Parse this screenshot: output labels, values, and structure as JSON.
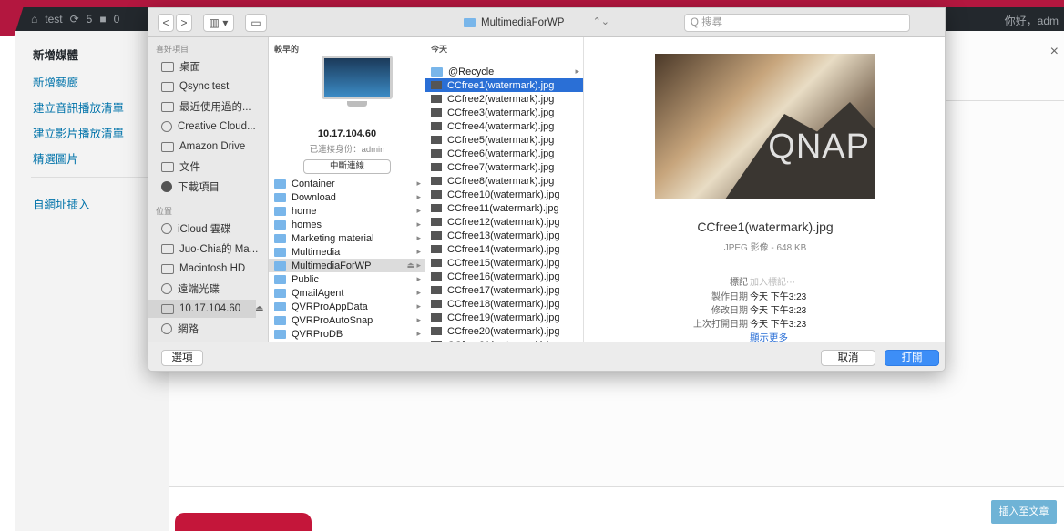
{
  "admin_bar": {
    "site": "test",
    "updates": "5",
    "comments": "0",
    "greeting": "你好，adm"
  },
  "wp": {
    "sidebar": [
      "新增媒體",
      "新增藝廊",
      "建立音訊播放清單",
      "建立影片播放清單",
      "精選圖片",
      "自網址插入"
    ],
    "close": "×",
    "insert_button": "插入至文章"
  },
  "finder": {
    "toolbar": {
      "back": "<",
      "forward": ">",
      "view": "▥ ▾",
      "new_folder": "▭",
      "location": "MultimediaForWP",
      "search_placeholder": "Q 搜尋"
    },
    "sidebar": {
      "favorites_header": "喜好項目",
      "favorites": [
        "桌面",
        "Qsync test",
        "最近使用過的...",
        "Creative Cloud...",
        "Amazon Drive",
        "文件",
        "下載項目"
      ],
      "locations_header": "位置",
      "locations": [
        "iCloud 雲碟",
        "Juo-Chia的 Ma...",
        "Macintosh HD",
        "遠端光碟",
        "10.17.104.60",
        "網路"
      ]
    },
    "col1": {
      "header": "較早的",
      "server_name": "10.17.104.60",
      "server_user": "已連接身份：admin",
      "disconnect": "中斷連線",
      "folders": [
        "Container",
        "Download",
        "home",
        "homes",
        "Marketing material",
        "Multimedia",
        "MultimediaForWP",
        "Public",
        "QmailAgent",
        "QVRProAppData",
        "QVRProAutoSnap",
        "QVRProDB",
        "QVRProRecording"
      ]
    },
    "col2": {
      "header": "今天",
      "items": [
        "@Recycle",
        "CCfree1(watermark).jpg",
        "CCfree2(watermark).jpg",
        "CCfree3(watermark).jpg",
        "CCfree4(watermark).jpg",
        "CCfree5(watermark).jpg",
        "CCfree6(watermark).jpg",
        "CCfree7(watermark).jpg",
        "CCfree8(watermark).jpg",
        "CCfree10(watermark).jpg",
        "CCfree11(watermark).jpg",
        "CCfree12(watermark).jpg",
        "CCfree13(watermark).jpg",
        "CCfree14(watermark).jpg",
        "CCfree15(watermark).jpg",
        "CCfree16(watermark).jpg",
        "CCfree17(watermark).jpg",
        "CCfree18(watermark).jpg",
        "CCfree19(watermark).jpg",
        "CCfree20(watermark).jpg",
        "CCfree21(watermark).jpg"
      ]
    },
    "preview": {
      "logo": "QNAP",
      "filename": "CCfree1(watermark).jpg",
      "kind": "JPEG 影像 - 648 KB",
      "tags_label": "標記",
      "tags_value": "加入標記⋯",
      "created_label": "製作日期",
      "created_value": "今天 下午3:23",
      "modified_label": "修改日期",
      "modified_value": "今天 下午3:23",
      "opened_label": "上次打開日期",
      "opened_value": "今天 下午3:23",
      "show_more": "顯示更多"
    },
    "footer": {
      "options": "選項",
      "cancel": "取消",
      "open": "打開"
    }
  }
}
